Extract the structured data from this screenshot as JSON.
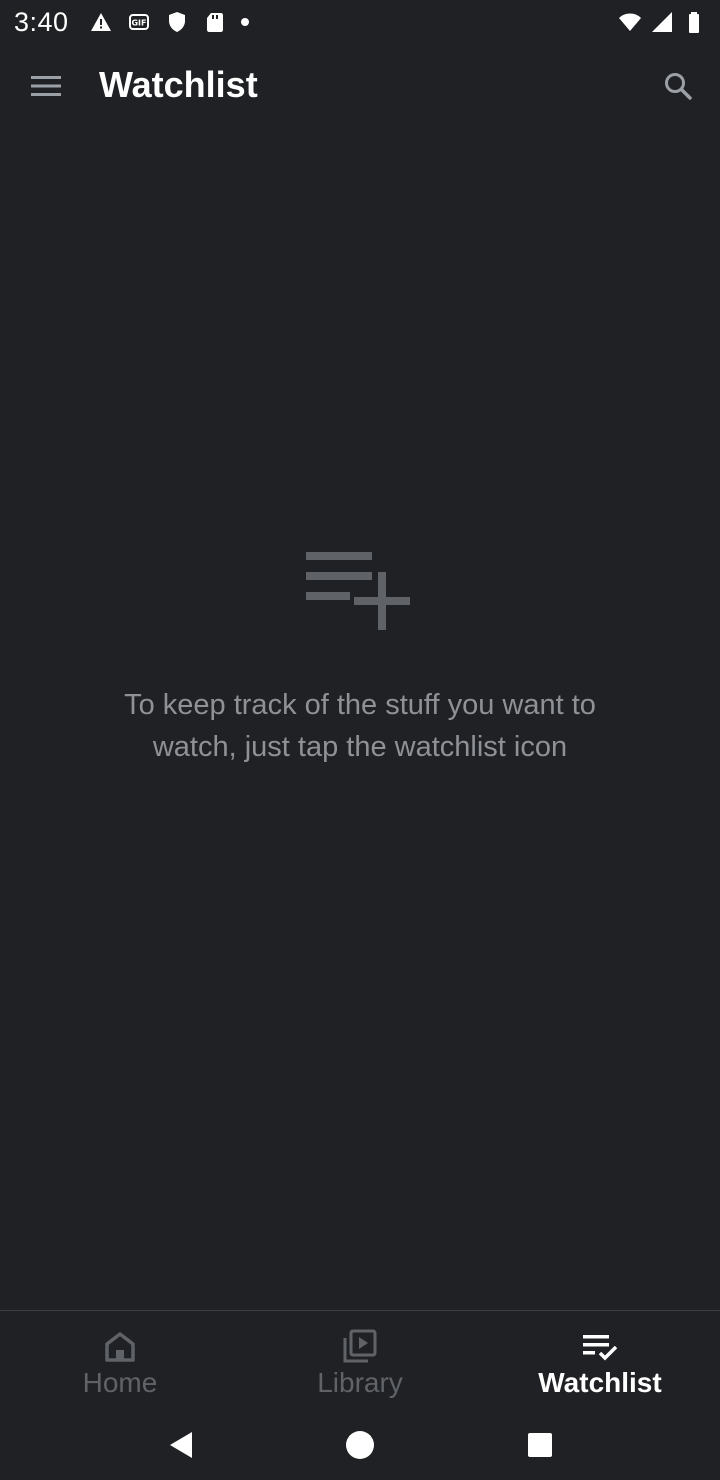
{
  "status_bar": {
    "time": "3:40",
    "icons_left": [
      "alert-icon",
      "gif-icon",
      "shield-icon",
      "sd-card-icon",
      "notification-dot-icon"
    ],
    "icons_right": [
      "wifi-icon",
      "signal-icon",
      "battery-icon"
    ]
  },
  "app_bar": {
    "title": "Watchlist",
    "menu_icon": "menu-icon",
    "search_icon": "search-icon"
  },
  "empty_state": {
    "icon": "playlist-add-icon",
    "message": "To keep track of the stuff you want to watch, just tap the watchlist icon"
  },
  "bottom_nav": {
    "items": [
      {
        "label": "Home",
        "icon": "home-icon",
        "active": false
      },
      {
        "label": "Library",
        "icon": "library-icon",
        "active": false
      },
      {
        "label": "Watchlist",
        "icon": "watchlist-icon",
        "active": true
      }
    ]
  },
  "system_nav": {
    "buttons": [
      "back-icon",
      "home-circle-icon",
      "recents-icon"
    ]
  },
  "colors": {
    "background": "#202124",
    "text_primary": "#ffffff",
    "text_secondary": "#8e9196",
    "inactive": "#5f6368",
    "icon_gray": "#9aa0a6"
  }
}
